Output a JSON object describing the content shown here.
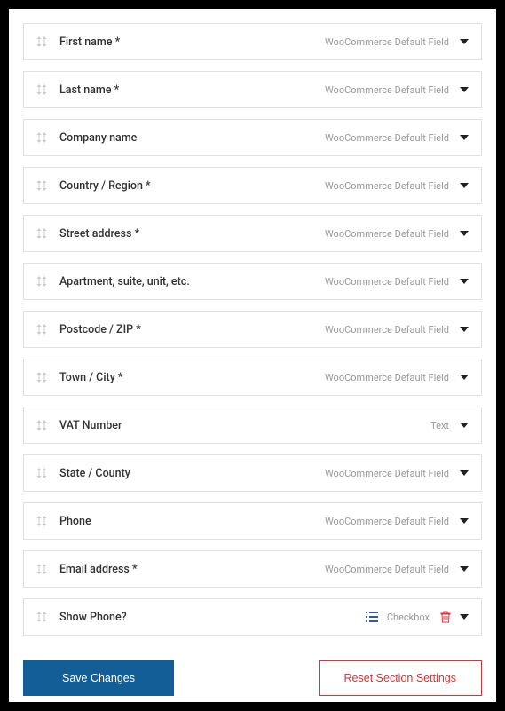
{
  "fields": [
    {
      "label": "First name *",
      "type": "WooCommerce Default Field",
      "custom": false
    },
    {
      "label": "Last name *",
      "type": "WooCommerce Default Field",
      "custom": false
    },
    {
      "label": "Company name",
      "type": "WooCommerce Default Field",
      "custom": false
    },
    {
      "label": "Country / Region *",
      "type": "WooCommerce Default Field",
      "custom": false
    },
    {
      "label": "Street address *",
      "type": "WooCommerce Default Field",
      "custom": false
    },
    {
      "label": "Apartment, suite, unit, etc.",
      "type": "WooCommerce Default Field",
      "custom": false
    },
    {
      "label": "Postcode / ZIP *",
      "type": "WooCommerce Default Field",
      "custom": false
    },
    {
      "label": "Town / City *",
      "type": "WooCommerce Default Field",
      "custom": false
    },
    {
      "label": "VAT Number",
      "type": "Text",
      "custom": false
    },
    {
      "label": "State / County",
      "type": "WooCommerce Default Field",
      "custom": false
    },
    {
      "label": "Phone",
      "type": "WooCommerce Default Field",
      "custom": false
    },
    {
      "label": "Email address *",
      "type": "WooCommerce Default Field",
      "custom": false
    },
    {
      "label": "Show Phone?",
      "type": "Checkbox",
      "custom": true
    }
  ],
  "buttons": {
    "save": "Save Changes",
    "reset": "Reset Section Settings"
  }
}
